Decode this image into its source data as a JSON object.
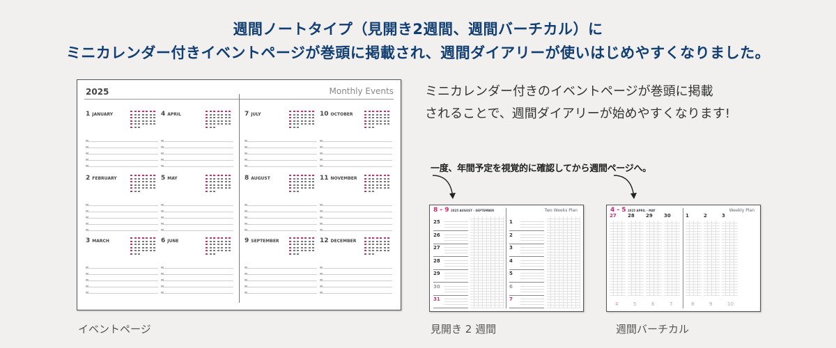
{
  "headline": {
    "line1": "週間ノートタイプ（見開き2週間、週間バーチカル）に",
    "line2": "ミニカレンダー付きイベントページが巻頭に掲載され、週間ダイアリーが使いはじめやすくなりました。"
  },
  "description": {
    "line1": "ミニカレンダー付きのイベントページが巻頭に掲載",
    "line2": "されることで、週間ダイアリーが始めやすくなります!"
  },
  "callout": "一度、年間予定を視覚的に確認してから週間ページへ。",
  "captions": {
    "monthly": "イベントページ",
    "two_weeks": "見開き 2 週間",
    "weekly": "週間バーチカル"
  },
  "monthly_page": {
    "year": "2025",
    "title": "Monthly Events",
    "months": [
      {
        "num": "1",
        "name": "JANUARY"
      },
      {
        "num": "4",
        "name": "APRIL"
      },
      {
        "num": "7",
        "name": "JULY"
      },
      {
        "num": "10",
        "name": "OCTOBER"
      },
      {
        "num": "2",
        "name": "FEBRUARY"
      },
      {
        "num": "5",
        "name": "MAY"
      },
      {
        "num": "8",
        "name": "AUGUST"
      },
      {
        "num": "11",
        "name": "NOVEMBER"
      },
      {
        "num": "3",
        "name": "MARCH"
      },
      {
        "num": "6",
        "name": "JUNE"
      },
      {
        "num": "9",
        "name": "SEPTEMBER"
      },
      {
        "num": "12",
        "name": "DECEMBER"
      }
    ]
  },
  "two_weeks_page": {
    "range": "8 - 9",
    "subtitle": "2025  AUGUST - SEPTEMBER",
    "title": "Two Weeks Plan",
    "left_days": [
      "25",
      "26",
      "27",
      "28",
      "29",
      "30",
      "31"
    ],
    "right_days": [
      "1",
      "2",
      "3",
      "4",
      "5",
      "6",
      "7"
    ]
  },
  "weekly_page": {
    "range": "4 - 5",
    "subtitle": "2025  APRIL - MAY",
    "title": "Weekly Plan",
    "days": [
      "27",
      "28",
      "29",
      "30",
      "1",
      "2",
      "3"
    ],
    "footer_days": [
      "4",
      "5",
      "6",
      "7",
      "8",
      "9",
      "10"
    ]
  },
  "colors": {
    "headline": "#123f73",
    "accent_pink": "#d2276e",
    "background": "#f1f0ee"
  }
}
